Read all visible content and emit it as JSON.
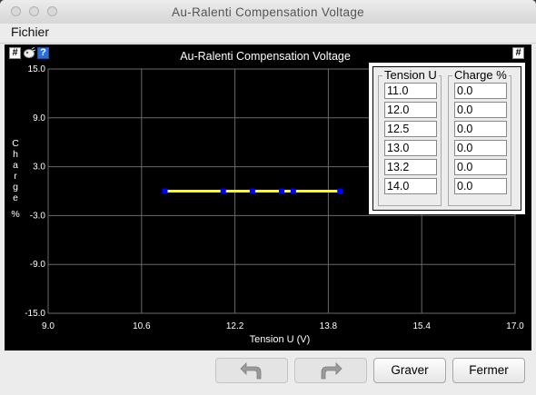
{
  "window": {
    "title": "Au-Ralenti Compensation Voltage"
  },
  "menu": {
    "file": "Fichier"
  },
  "toolbar": {
    "hash_glyph": "#",
    "help_glyph": "?"
  },
  "chart_data": {
    "type": "line",
    "title": "Au-Ralenti Compensation Voltage",
    "xlabel": "Tension U  (V)",
    "ylabel": "Charge %",
    "xlim": [
      9.0,
      17.0
    ],
    "ylim": [
      -15.0,
      15.0
    ],
    "x_ticks": [
      "9.0",
      "10.6",
      "12.2",
      "13.8",
      "15.4",
      "17.0"
    ],
    "y_ticks": [
      "15.0",
      "9.0",
      "3.0",
      "-3.0",
      "-9.0",
      "-15.0"
    ],
    "grid": true,
    "line_color": "#ffff00",
    "marker_color": "#0000ff",
    "series": [
      {
        "x": [
          11.0,
          12.0,
          12.5,
          13.0,
          13.2,
          14.0
        ],
        "y": [
          0.0,
          0.0,
          0.0,
          0.0,
          0.0,
          0.0
        ]
      }
    ]
  },
  "table": {
    "headers": [
      "Tension U",
      "Charge %"
    ],
    "tension": [
      "11.0",
      "12.0",
      "12.5",
      "13.0",
      "13.2",
      "14.0"
    ],
    "charge": [
      "0.0",
      "0.0",
      "0.0",
      "0.0",
      "0.0",
      "0.0"
    ]
  },
  "buttons": {
    "undo_icon": "undo-arrow",
    "redo_icon": "redo-arrow",
    "burn": "Graver",
    "close": "Fermer"
  }
}
